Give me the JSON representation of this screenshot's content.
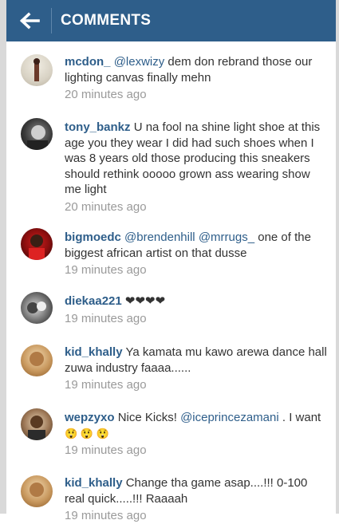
{
  "header": {
    "title": "COMMENTS",
    "back_icon": "arrow-left-icon",
    "background": "#2e5e8a"
  },
  "comments": [
    {
      "user": "mcdon_",
      "mention": "@lexwizy",
      "text": " dem don rebrand those our lighting canvas finally mehn",
      "time": "20 minutes ago"
    },
    {
      "user": "tony_bankz",
      "text": "U na fool na shine light shoe at this age you they wear I did had such shoes when I was 8 years old those producing this sneakers should rethink ooooo grown ass wearing show me light",
      "time": "20 minutes ago"
    },
    {
      "user": "bigmoedc",
      "mention": "@brendenhill",
      "mention2": "@mrrugs_",
      "text": " one of the biggest african artist on that dusse",
      "time": "19 minutes ago"
    },
    {
      "user": "diekaa221",
      "text": "❤❤❤❤",
      "time": "19 minutes ago"
    },
    {
      "user": "kid_khally",
      "text": "Ya kamata mu kawo arewa dance hall zuwa industry faaaa......",
      "time": "19 minutes ago"
    },
    {
      "user": "wepzyxo",
      "text_pre": "Nice Kicks! ",
      "mention": "@iceprincezamani",
      "text_post": " . I want ",
      "emoji": "😲 😲 😲",
      "time": "19 minutes ago"
    },
    {
      "user": "kid_khally",
      "text": "Change tha game asap....!!! 0-100 real quick.....!!! Raaaah",
      "time": "19 minutes ago"
    }
  ]
}
